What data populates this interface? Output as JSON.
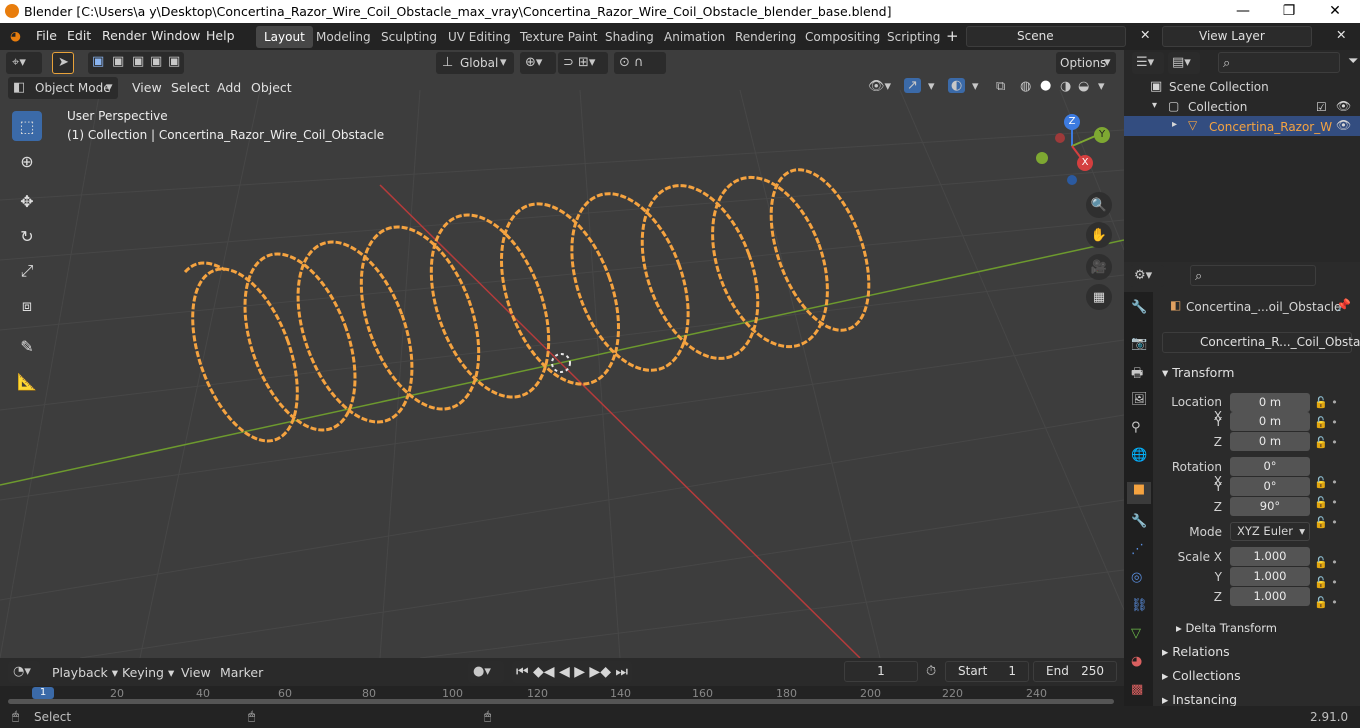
{
  "titlebar": {
    "title": "Blender [C:\\Users\\a y\\Desktop\\Concertina_Razor_Wire_Coil_Obstacle_max_vray\\Concertina_Razor_Wire_Coil_Obstacle_blender_base.blend]",
    "minimize": "—",
    "maximize": "❐",
    "close": "✕"
  },
  "menus": [
    "File",
    "Edit",
    "Render",
    "Window",
    "Help"
  ],
  "workspaces": [
    "Layout",
    "Modeling",
    "Sculpting",
    "UV Editing",
    "Texture Paint",
    "Shading",
    "Animation",
    "Rendering",
    "Compositing",
    "Scripting"
  ],
  "active_workspace": "Layout",
  "scene": "Scene",
  "view_layer": "View Layer",
  "viewport": {
    "transform_orientation": "Global",
    "options": "Options",
    "mode": "Object Mode",
    "header_menus": [
      "View",
      "Select",
      "Add",
      "Object"
    ],
    "overlay_title": "User Perspective",
    "overlay_subtitle": "(1) Collection | Concertina_Razor_Wire_Coil_Obstacle",
    "gizmo": {
      "x": "X",
      "y": "Y",
      "z": "Z"
    }
  },
  "timeline": {
    "menus": [
      "Playback",
      "Keying",
      "View",
      "Marker"
    ],
    "current_frame": "1",
    "start_label": "Start",
    "start": "1",
    "end_label": "End",
    "end": "250",
    "ruler": [
      "1",
      "20",
      "40",
      "60",
      "80",
      "100",
      "120",
      "140",
      "160",
      "180",
      "200",
      "220",
      "240"
    ]
  },
  "outliner": {
    "scene_collection": "Scene Collection",
    "collection": "Collection",
    "object": "Concertina_Razor_W"
  },
  "properties": {
    "object_name": "Concertina_...oil_Obstacle",
    "data_name": "Concertina_R..._Coil_Obstacle",
    "transform": "Transform",
    "location_label": "Location X",
    "y": "Y",
    "z": "Z",
    "location": [
      "0 m",
      "0 m",
      "0 m"
    ],
    "rotation_label": "Rotation X",
    "rotation": [
      "0°",
      "0°",
      "90°"
    ],
    "mode_label": "Mode",
    "mode": "XYZ Euler",
    "scale_label": "Scale X",
    "scale": [
      "1.000",
      "1.000",
      "1.000"
    ],
    "delta": "Delta Transform",
    "relations": "Relations",
    "collections": "Collections",
    "instancing": "Instancing"
  },
  "status": {
    "select": "Select",
    "version": "2.91.0"
  },
  "colors": {
    "accent": "#3b6aa8",
    "selection": "#f5a340",
    "x_axis": "#d43f3f",
    "y_axis": "#7ea832",
    "z_axis": "#3d7be0"
  }
}
